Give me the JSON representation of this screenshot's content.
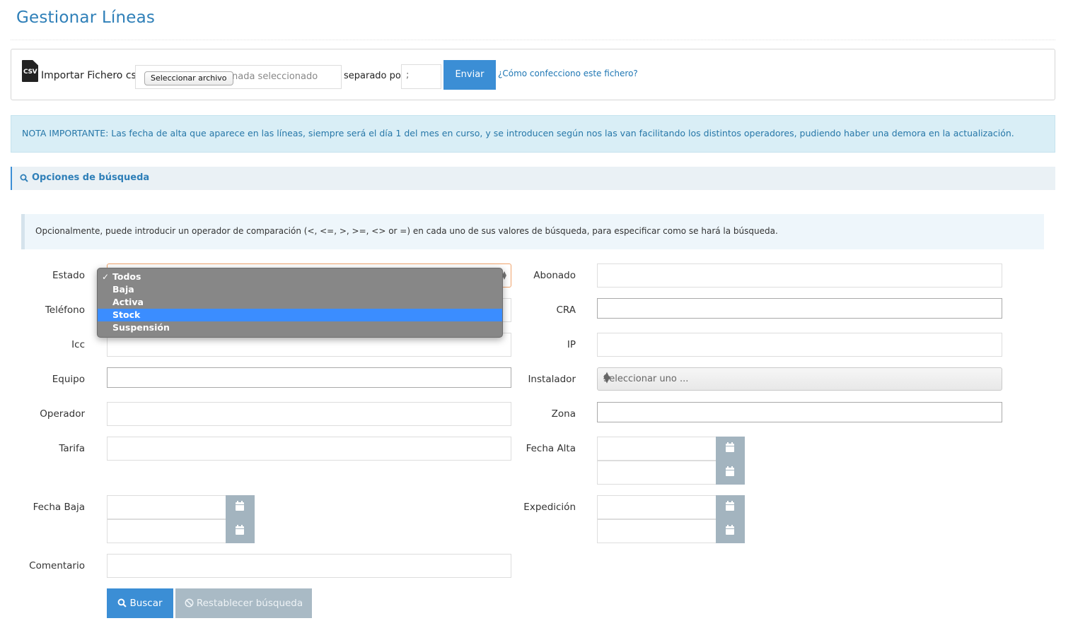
{
  "page": {
    "title": "Gestionar Líneas"
  },
  "import": {
    "icon": "csv-file-icon",
    "icon_text": "CSV",
    "label": "Importar Fichero csv",
    "file_button": "Seleccionar archivo",
    "file_status": "nada seleccionado",
    "separator_label": "separado por",
    "separator_value": ";",
    "send_label": "Enviar",
    "help_link": "¿Cómo confecciono este fichero?"
  },
  "note": "NOTA IMPORTANTE: Las fecha de alta que aparece en las líneas, siempre será el día 1 del mes en curso, y se introducen según nos las van facilitando los distintos operadores, pudiendo haber una demora en la actualización.",
  "search": {
    "section_title": "Opciones de búsqueda",
    "info": "Opcionalmente, puede introducir un operador de comparación (<, <=, >, >=, <> or =) en cada uno de sus valores de búsqueda, para especificar como se hará la búsqueda."
  },
  "fields": {
    "estado": "Estado",
    "telefono": "Teléfono",
    "icc": "Icc",
    "equipo": "Equipo",
    "operador": "Operador",
    "tarifa": "Tarifa",
    "fecha_baja": "Fecha Baja",
    "comentario": "Comentario",
    "abonado": "Abonado",
    "cra": "CRA",
    "ip": "IP",
    "instalador": "Instalador",
    "zona": "Zona",
    "fecha_alta": "Fecha Alta",
    "expedicion": "Expedición"
  },
  "instalador_placeholder": "Seleccionar uno ...",
  "estado_dropdown": {
    "options": [
      "Todos",
      "Baja",
      "Activa",
      "Stock",
      "Suspensión"
    ],
    "selected": "Todos",
    "highlighted": "Stock"
  },
  "buttons": {
    "buscar": "Buscar",
    "reset": "Restablecer búsqueda"
  },
  "colors": {
    "primary": "#3b8ed5",
    "title": "#2e7fb8",
    "note_bg": "#d9eef6",
    "dropdown_bg": "#878787",
    "highlight": "#3b8dff",
    "date_button": "#a3b4bf"
  }
}
